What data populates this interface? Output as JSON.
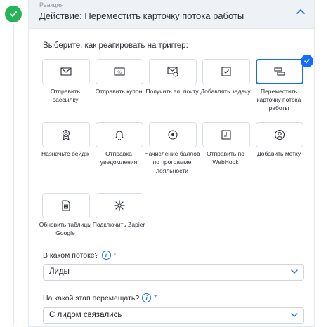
{
  "header": {
    "small_label": "Реакция",
    "title": "Действие: Переместить карточку потока работы"
  },
  "prompt": "Выберите, как реагировать на триггер:",
  "actions": [
    {
      "label": "Отправить рассылку",
      "icon": "envelope-icon",
      "selected": false
    },
    {
      "label": "Отправить купон",
      "icon": "coupon-icon",
      "selected": false
    },
    {
      "label": "Получить эл. почту",
      "icon": "email-receive-icon",
      "selected": false
    },
    {
      "label": "Добавлять задачу",
      "icon": "task-check-icon",
      "selected": false
    },
    {
      "label": "Переместить карточку потока работы",
      "icon": "workflow-card-icon",
      "selected": true
    },
    {
      "label": "Назначьте бейдж",
      "icon": "badge-icon",
      "selected": false
    },
    {
      "label": "Отправка уведомления",
      "icon": "bell-icon",
      "selected": false
    },
    {
      "label": "Начисление баллов по программе лояльности",
      "icon": "loyalty-points-icon",
      "selected": false
    },
    {
      "label": "Отправить по WebHook",
      "icon": "webhook-icon",
      "selected": false
    },
    {
      "label": "Добавить метку",
      "icon": "label-user-icon",
      "selected": false
    },
    {
      "label": "Обновить таблицы Google",
      "icon": "google-sheets-icon",
      "selected": false
    },
    {
      "label": "Подключить Zapier",
      "icon": "zapier-icon",
      "selected": false
    }
  ],
  "flow_question": {
    "label": "В каком потоке?",
    "required_mark": "*",
    "info": "i",
    "value": "Лиды"
  },
  "stage_question": {
    "label": "На какой этап перемещать?",
    "required_mark": "*",
    "info": "i",
    "value": "С лидом связались"
  },
  "colors": {
    "accent": "#116dff",
    "success": "#27b35a",
    "header_bg": "#eef1f5"
  }
}
